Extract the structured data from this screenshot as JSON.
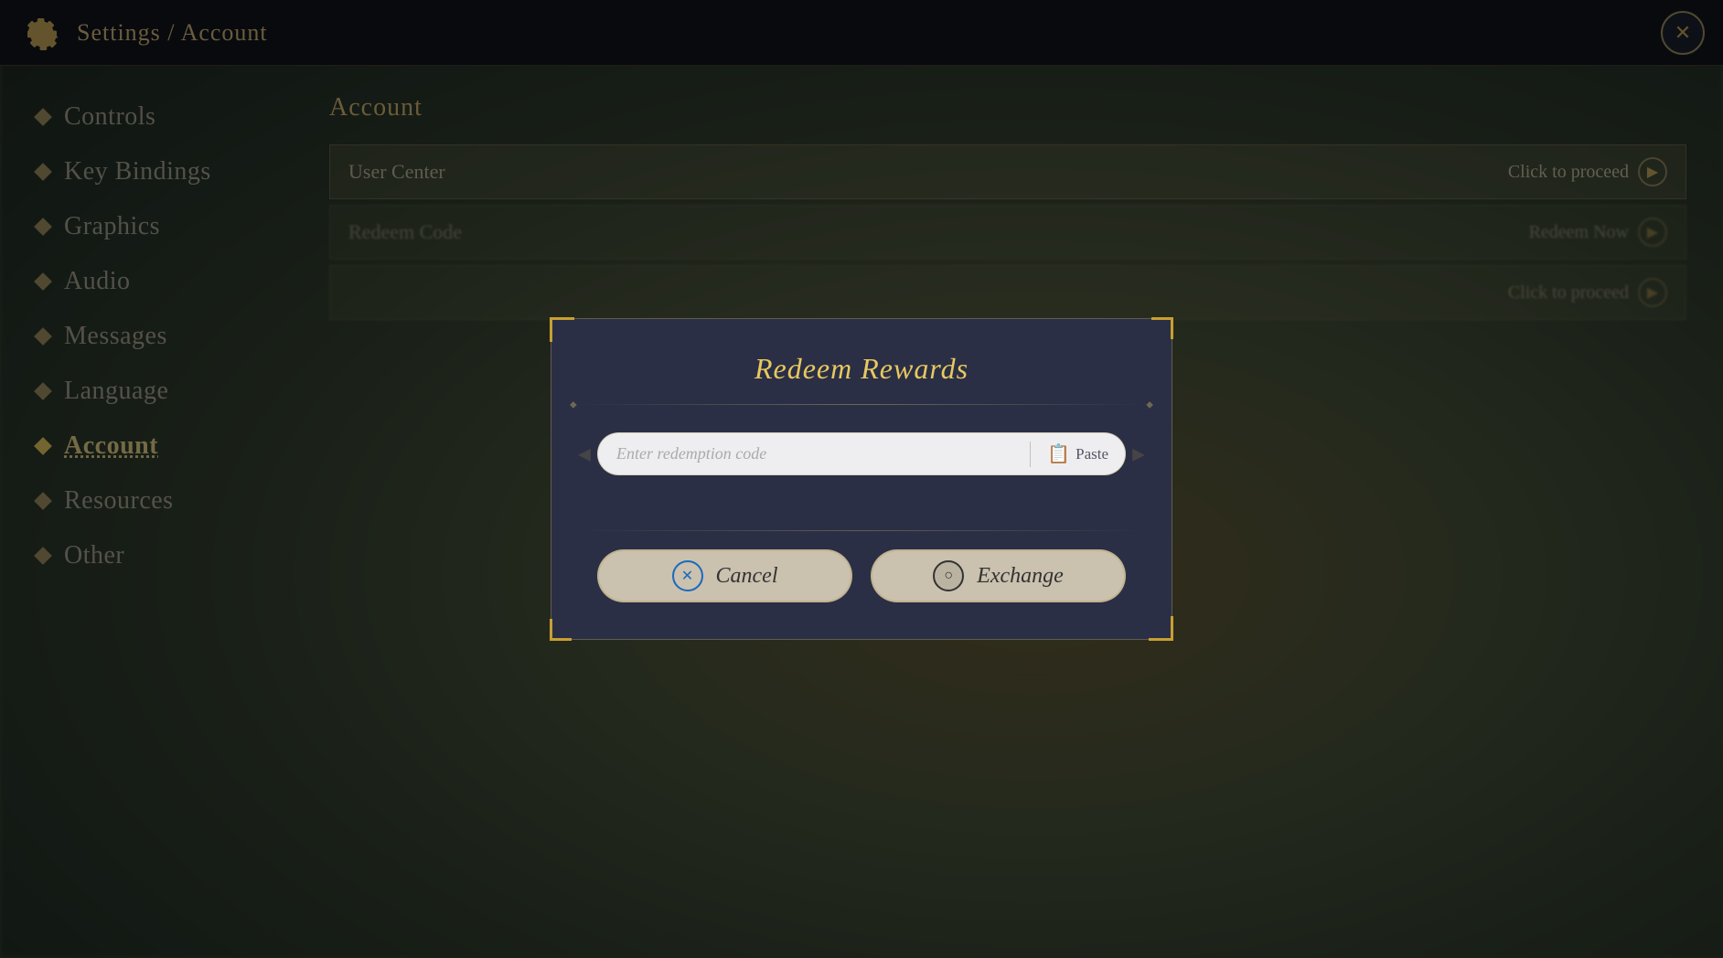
{
  "header": {
    "title": "Settings / Account",
    "close_label": "✕"
  },
  "sidebar": {
    "items": [
      {
        "id": "controls",
        "label": "Controls",
        "active": false
      },
      {
        "id": "key-bindings",
        "label": "Key Bindings",
        "active": false
      },
      {
        "id": "graphics",
        "label": "Graphics",
        "active": false
      },
      {
        "id": "audio",
        "label": "Audio",
        "active": false
      },
      {
        "id": "messages",
        "label": "Messages",
        "active": false
      },
      {
        "id": "language",
        "label": "Language",
        "active": false
      },
      {
        "id": "account",
        "label": "Account",
        "active": true
      },
      {
        "id": "resources",
        "label": "Resources",
        "active": false
      },
      {
        "id": "other",
        "label": "Other",
        "active": false
      }
    ]
  },
  "account_section": {
    "title": "Account",
    "rows": [
      {
        "id": "user-center",
        "label": "User Center",
        "action": "Click to proceed"
      },
      {
        "id": "redeem-code",
        "label": "Redeem Code",
        "action": "Redeem Now"
      },
      {
        "id": "row3",
        "label": "",
        "action": "Click to proceed"
      }
    ]
  },
  "modal": {
    "title": "Redeem Rewards",
    "input_placeholder": "Enter redemption code",
    "paste_label": "Paste",
    "cancel_label": "Cancel",
    "exchange_label": "Exchange"
  },
  "icons": {
    "gear": "⚙",
    "close": "✕",
    "arrow_right": "▶",
    "arrow_left": "◀",
    "paste": "📋",
    "cancel_x": "✕",
    "exchange_o": "◯"
  }
}
